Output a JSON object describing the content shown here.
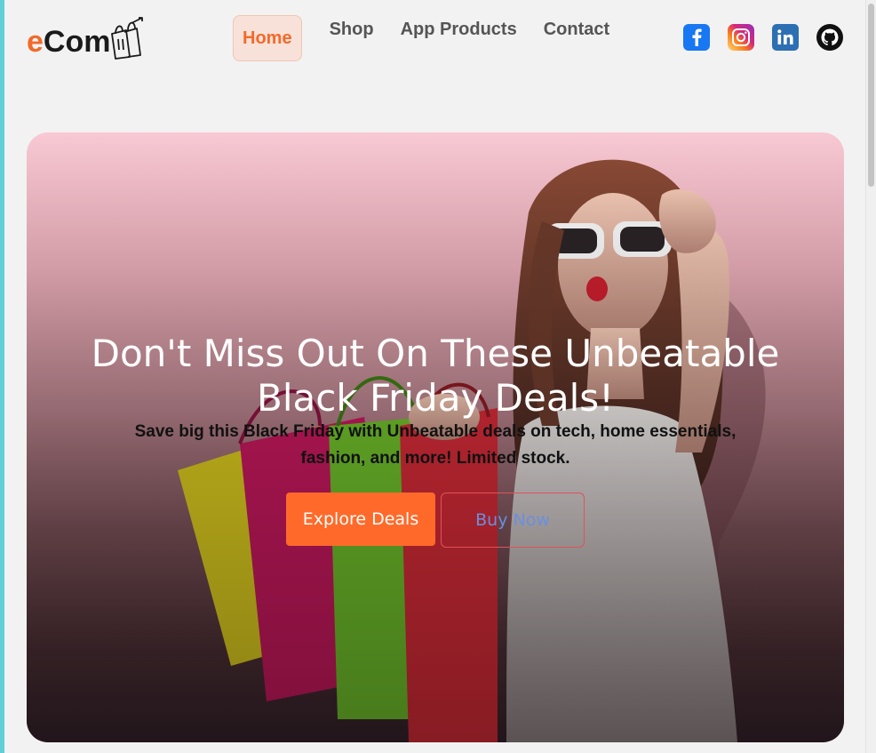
{
  "brand": {
    "logo_e": "e",
    "logo_com": "Com"
  },
  "nav": {
    "items": [
      {
        "label": "Home",
        "active": true
      },
      {
        "label": "Shop",
        "active": false
      },
      {
        "label": "App Products",
        "active": false
      },
      {
        "label": "Contact",
        "active": false
      }
    ]
  },
  "socials": [
    "facebook-icon",
    "instagram-icon",
    "linkedin-icon",
    "github-icon"
  ],
  "hero": {
    "title": "Don't Miss Out On These Unbeatable Black Friday Deals!",
    "subtitle": "Save big this Black Friday with Unbeatable deals on tech, home essentials, fashion, and more! Limited stock.",
    "primary_button": "Explore Deals",
    "secondary_button": "Buy Now"
  },
  "colors": {
    "accent": "#ff6a2a",
    "nav_active_bg": "#f8e1d8",
    "outline_text": "#6a8fe0"
  }
}
